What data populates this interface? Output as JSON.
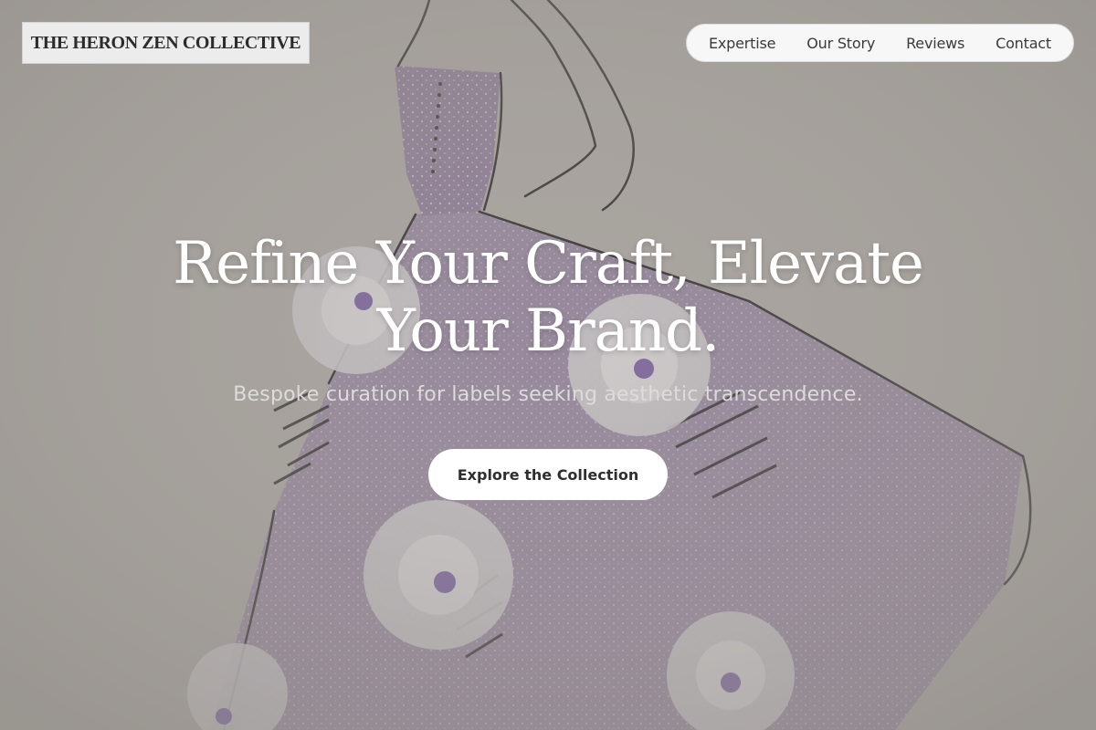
{
  "brand": {
    "name": "THE HERON ZEN COLLECTIVE"
  },
  "nav": {
    "items": [
      {
        "label": "Expertise"
      },
      {
        "label": "Our Story"
      },
      {
        "label": "Reviews"
      },
      {
        "label": "Contact"
      }
    ]
  },
  "hero": {
    "headline_line1": "Refine Your Craft, Elevate",
    "headline_line2": "Your Brand.",
    "subheadline": "Bespoke curation for labels seeking aesthetic transcendence.",
    "cta_label": "Explore the Collection",
    "background_image": "fashion-sketch-lavender-ball-gown"
  },
  "colors": {
    "overlay": "#a8a49f",
    "gown": "#9a8aa6",
    "rose": "#d9d6da",
    "accent_purple": "#7b5ea7",
    "headline": "#ffffff",
    "cta_bg": "#ffffff",
    "cta_text": "#2f2f2f"
  }
}
